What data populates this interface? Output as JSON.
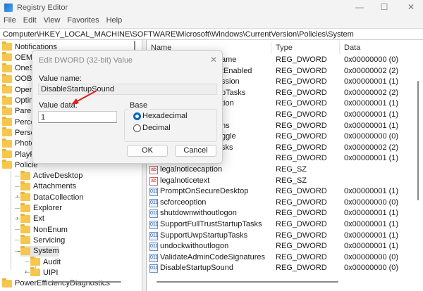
{
  "window": {
    "title": "Registry Editor",
    "minimize": "—",
    "maximize": "☐",
    "close": "✕"
  },
  "menu": [
    "File",
    "Edit",
    "View",
    "Favorites",
    "Help"
  ],
  "address": "Computer\\HKEY_LOCAL_MACHINE\\SOFTWARE\\Microsoft\\Windows\\CurrentVersion\\Policies\\System",
  "tree": [
    {
      "label": "Notifications",
      "level": 0
    },
    {
      "label": "OEMIn",
      "level": 0
    },
    {
      "label": "OneSe",
      "level": 0
    },
    {
      "label": "OOBE",
      "level": 0
    },
    {
      "label": "OpenW",
      "level": 0
    },
    {
      "label": "Optim",
      "level": 0
    },
    {
      "label": "Parent",
      "level": 0
    },
    {
      "label": "Percep",
      "level": 0
    },
    {
      "label": "Person",
      "level": 0
    },
    {
      "label": "PhotoF",
      "level": 0
    },
    {
      "label": "PlayRe",
      "level": 0
    },
    {
      "label": "Policie",
      "level": 0
    },
    {
      "label": "ActiveDesktop",
      "level": 1
    },
    {
      "label": "Attachments",
      "level": 1
    },
    {
      "label": "DataCollection",
      "level": 1,
      "chev": "›"
    },
    {
      "label": "Explorer",
      "level": 1
    },
    {
      "label": "Ext",
      "level": 1,
      "chev": "›"
    },
    {
      "label": "NonEnum",
      "level": 1
    },
    {
      "label": "Servicing",
      "level": 1
    },
    {
      "label": "System",
      "level": 1,
      "chev": "⌄",
      "selected": true
    },
    {
      "label": "Audit",
      "level": 2
    },
    {
      "label": "UIPI",
      "level": 2,
      "chev": "›"
    },
    {
      "label": "PowerEfficiencyDiagnostics",
      "level": 0
    }
  ],
  "list": {
    "headers": {
      "name": "Name",
      "type": "Type",
      "data": "Data"
    },
    "rows": [
      {
        "name": "ame",
        "type": "REG_DWORD",
        "data": "0x00000000 (0)",
        "hidden": true
      },
      {
        "name": "tEnabled",
        "type": "REG_DWORD",
        "data": "0x00000002 (2)",
        "hidden": true
      },
      {
        "name": "ssion",
        "type": "REG_DWORD",
        "data": "0x00000001 (1)",
        "hidden": true
      },
      {
        "name": "pTasks",
        "type": "REG_DWORD",
        "data": "0x00000002 (2)",
        "hidden": true
      },
      {
        "name": "tion",
        "type": "REG_DWORD",
        "data": "0x00000001 (1)",
        "hidden": true
      },
      {
        "name": "",
        "type": "REG_DWORD",
        "data": "0x00000001 (1)",
        "hidden": true
      },
      {
        "name": "ns",
        "type": "REG_DWORD",
        "data": "0x00000001 (1)",
        "hidden": true
      },
      {
        "name": "ggle",
        "type": "REG_DWORD",
        "data": "0x00000000 (0)",
        "hidden": true
      },
      {
        "name": "sks",
        "type": "REG_DWORD",
        "data": "0x00000002 (2)",
        "hidden": true
      },
      {
        "name": "",
        "type": "REG_DWORD",
        "data": "0x00000001 (1)",
        "hidden": true
      },
      {
        "name": "legalnoticecaption",
        "type": "REG_SZ",
        "data": "",
        "icon": "ab"
      },
      {
        "name": "legalnoticetext",
        "type": "REG_SZ",
        "data": "",
        "icon": "ab"
      },
      {
        "name": "PromptOnSecureDesktop",
        "type": "REG_DWORD",
        "data": "0x00000001 (1)",
        "icon": "dw"
      },
      {
        "name": "scforceoption",
        "type": "REG_DWORD",
        "data": "0x00000000 (0)",
        "icon": "dw"
      },
      {
        "name": "shutdownwithoutlogon",
        "type": "REG_DWORD",
        "data": "0x00000001 (1)",
        "icon": "dw"
      },
      {
        "name": "SupportFullTrustStartupTasks",
        "type": "REG_DWORD",
        "data": "0x00000001 (1)",
        "icon": "dw"
      },
      {
        "name": "SupportUwpStartupTasks",
        "type": "REG_DWORD",
        "data": "0x00000001 (1)",
        "icon": "dw"
      },
      {
        "name": "undockwithoutlogon",
        "type": "REG_DWORD",
        "data": "0x00000001 (1)",
        "icon": "dw"
      },
      {
        "name": "ValidateAdminCodeSignatures",
        "type": "REG_DWORD",
        "data": "0x00000000 (0)",
        "icon": "dw"
      },
      {
        "name": "DisableStartupSound",
        "type": "REG_DWORD",
        "data": "0x00000000 (0)",
        "icon": "dw"
      }
    ]
  },
  "dialog": {
    "title": "Edit DWORD (32-bit) Value",
    "close": "✕",
    "value_name_label": "Value name:",
    "value_name": "DisableStartupSound",
    "value_data_label": "Value data:",
    "value_data": "1",
    "base_label": "Base",
    "hex_label": "Hexadecimal",
    "dec_label": "Decimal",
    "ok": "OK",
    "cancel": "Cancel"
  },
  "colors": {
    "accent": "#0067c0",
    "arrow": "#e02020"
  }
}
